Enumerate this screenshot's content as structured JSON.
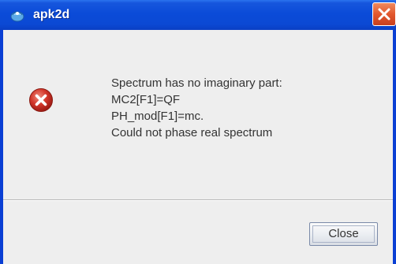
{
  "window": {
    "title": "apk2d",
    "app_icon": "apk2d-app-icon",
    "close_icon": "close-icon"
  },
  "dialog": {
    "icon": "error-icon",
    "message_lines": [
      "Spectrum has no imaginary part:",
      "MC2[F1]=QF",
      "PH_mod[F1]=mc.",
      "Could not phase real spectrum"
    ],
    "close_button_label": "Close"
  },
  "colors": {
    "titlebar": "#0b4bd8",
    "titlebar_close": "#e2572d",
    "dialog_bg": "#eeeeee",
    "error_red": "#c8251c",
    "text": "#333333"
  }
}
